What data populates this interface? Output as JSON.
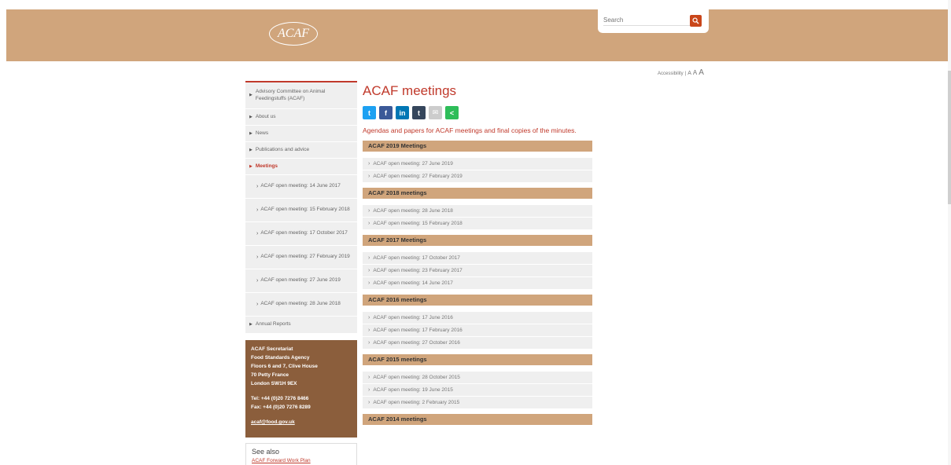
{
  "header": {
    "logo_text": "ACAF",
    "search": {
      "placeholder": "Search"
    }
  },
  "accessibility": {
    "label": "Accessibility",
    "sizes": [
      "A",
      "A",
      "A"
    ]
  },
  "sidebar": {
    "items": [
      {
        "label": "Advisory Committee on Animal Feedingstuffs (ACAF)"
      },
      {
        "label": "About us"
      },
      {
        "label": "News"
      },
      {
        "label": "Publications and advice"
      },
      {
        "label": "Meetings",
        "active": true
      }
    ],
    "subitems": [
      {
        "label": "ACAF open meeting: 14 June 2017"
      },
      {
        "label": "ACAF open meeting: 15 February 2018"
      },
      {
        "label": "ACAF open meeting: 17 October 2017"
      },
      {
        "label": "ACAF open meeting: 27 February 2019"
      },
      {
        "label": "ACAF open meeting: 27 June 2019"
      },
      {
        "label": "ACAF open meeting: 28 June 2018"
      }
    ],
    "last_item": {
      "label": "Annual Reports"
    },
    "contact": {
      "lines": [
        "ACAF Secretariat",
        "Food Standards Agency",
        "Floors 6 and 7, Clive House",
        "70 Petty France",
        "London SW1H 9EX"
      ],
      "tel": "Tel: +44 (0)20 7276 8466",
      "fax": "Fax: +44 (0)20 7276 8289",
      "email": "acaf@food.gov.uk"
    },
    "see_also": {
      "title": "See also",
      "link": "ACAF Forward Work Plan"
    }
  },
  "main": {
    "title": "ACAF meetings",
    "share": [
      {
        "icon": "twitter-icon",
        "glyph": "t",
        "color": "#1da1f2"
      },
      {
        "icon": "facebook-icon",
        "glyph": "f",
        "color": "#3b5998"
      },
      {
        "icon": "linkedin-icon",
        "glyph": "in",
        "color": "#0077b5"
      },
      {
        "icon": "tumblr-icon",
        "glyph": "t",
        "color": "#35465c"
      },
      {
        "icon": "email-icon",
        "glyph": "✉",
        "color": "#cccccc"
      },
      {
        "icon": "share-icon",
        "glyph": "<",
        "color": "#2ebd59"
      }
    ],
    "intro": "Agendas and papers for ACAF meetings and final copies of the minutes.",
    "sections": [
      {
        "title": "ACAF 2019 Meetings",
        "items": [
          "ACAF open meeting: 27 June 2019",
          "ACAF open meeting: 27 February 2019"
        ]
      },
      {
        "title": "ACAF 2018 meetings",
        "items": [
          "ACAF open meeting: 28 June 2018",
          "ACAF open meeting: 15 February 2018"
        ]
      },
      {
        "title": "ACAF 2017 Meetings",
        "items": [
          "ACAF open meeting: 17 October 2017",
          "ACAF open meeting: 23 February 2017",
          "ACAF open meeting: 14 June 2017"
        ]
      },
      {
        "title": "ACAF 2016 meetings",
        "items": [
          "ACAF open meeting: 17 June 2016",
          "ACAF open meeting: 17 February 2016",
          "ACAF open meeting: 27 October 2016"
        ]
      },
      {
        "title": "ACAF 2015 meetings",
        "items": [
          "ACAF open meeting: 28 October 2015",
          "ACAF open meeting: 19 June 2015",
          "ACAF open meeting: 2 February 2015"
        ]
      },
      {
        "title": "ACAF 2014 meetings",
        "items": []
      }
    ]
  },
  "colors": {
    "header": "#d0a57c",
    "accent": "#c0392b",
    "contact_bg": "#8b5e3c"
  }
}
